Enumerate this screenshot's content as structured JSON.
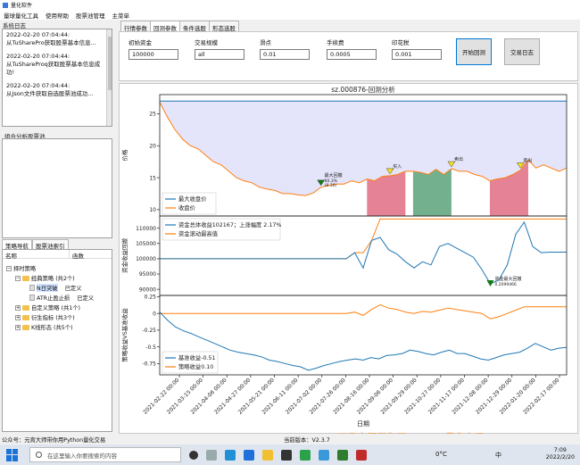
{
  "window": {
    "title": "量化软件"
  },
  "menu": [
    "量球量化工具",
    "使用帮助",
    "股票池管理",
    "主菜单"
  ],
  "log": {
    "title": "系统日志",
    "entries": [
      "2022-02-20 07:04:44:\n从TuSharePro获取股票基本信息...",
      "2022-02-20 07:04:44:\n从TuShareProq获取股票基本信息成功!",
      "2022-02-20 07:04:44:\n从Json文件获取自选股票池成功..."
    ]
  },
  "combo_title": "组合分析股票池",
  "nav_tabs": [
    "策略导航",
    "股票池索引"
  ],
  "tree": {
    "headers": [
      "名称",
      "函数"
    ],
    "rows": [
      {
        "label": "择时策略",
        "value": ""
      },
      {
        "label": "经典策略 (共2个)",
        "value": ""
      },
      {
        "label": "N日突破",
        "value": "已定义"
      },
      {
        "label": "ATR止盈止损",
        "value": "已定义"
      },
      {
        "label": "自定义策略 (共1个)",
        "value": ""
      },
      {
        "label": "衍生指标 (共3个)",
        "value": ""
      },
      {
        "label": "K线形态 (共5个)",
        "value": ""
      }
    ]
  },
  "tabs": [
    "行情参数",
    "回测参数",
    "条件选股",
    "形态选股"
  ],
  "params": {
    "capital": {
      "label": "初始资金",
      "value": "100000"
    },
    "size": {
      "label": "交易规模",
      "value": "all"
    },
    "slippage": {
      "label": "滑点",
      "value": "0.01"
    },
    "fee": {
      "label": "手续费",
      "value": "0.0005"
    },
    "stamp": {
      "label": "印花税",
      "value": "0.001"
    },
    "start_btn": "开始回测",
    "log_btn": "交易日志"
  },
  "status": {
    "left": "公众号：元宵大师带你用Python量化交易",
    "version": "当前版本：V2.3.7"
  },
  "taskbar": {
    "search_placeholder": "在这里输入你要搜索的内容",
    "weather": "0°C",
    "lang": "中",
    "time": "7:09",
    "date": "2022/2/20"
  },
  "watermark": "元宵大师带你用Python量化交易",
  "colors": {
    "blue": "#1f77b4",
    "orange": "#ff7f0e",
    "red_fill": "#e06c84",
    "green_fill": "#5aa37a",
    "lavender": "#e4e4fb"
  },
  "chart_data": [
    {
      "type": "line",
      "title": "sz.000876-回测分析",
      "ylabel": "价格",
      "ylim": [
        9,
        28
      ],
      "yticks": [
        10,
        15,
        20,
        25
      ],
      "series": [
        {
          "name": "最大收盘价",
          "values": [
            27,
            27
          ]
        },
        {
          "name": "收盘价",
          "values": [
            26.8,
            24.5,
            22.5,
            21,
            20,
            19.5,
            18.5,
            17.5,
            17,
            16,
            15,
            14.5,
            14.2,
            13.5,
            13.2,
            13,
            12.5,
            12.5,
            12.3,
            12.2,
            12.6,
            13.5,
            13.8,
            14,
            14,
            14.5,
            14.2,
            14.8,
            14.5,
            15.2,
            15.3,
            15.5,
            16,
            16,
            15.8,
            15.5,
            16.3,
            15.5,
            16.4,
            16,
            16,
            15.5,
            15.2,
            14.5,
            14.8,
            15,
            15.5,
            16.2,
            17.8,
            16.5,
            17,
            16.5,
            16,
            16.5
          ]
        },
        {
          "name": "",
          "values": []
        }
      ],
      "annotations": [
        "买入",
        "卖出",
        "卖出",
        "卖出",
        "最大回撤",
        "60.3%",
        "(8.30)"
      ]
    },
    {
      "type": "line",
      "ylabel": "资金收益回撤",
      "ylim": [
        88000,
        114000
      ],
      "yticks": [
        90000,
        95000,
        100000,
        105000,
        110000
      ],
      "series": [
        {
          "name": "资金总体收益102167；上涨幅度 2.17%",
          "values": [
            100000,
            100000,
            100000,
            100000,
            100000,
            100000,
            100000,
            100000,
            100000,
            100000,
            100000,
            100000,
            100000,
            100000,
            100000,
            100000,
            100000,
            100000,
            100000,
            100000,
            100000,
            100000,
            100000,
            102000,
            97000,
            106000,
            107000,
            103000,
            101500,
            99000,
            97000,
            99000,
            98000,
            104000,
            105000,
            103500,
            102000,
            100500,
            96500,
            91800,
            93000,
            98000,
            108000,
            112000,
            104000,
            102000,
            102167,
            102167,
            102167
          ]
        },
        {
          "name": "资金滚动最高值",
          "values": [
            100000,
            100000,
            100000,
            100000,
            100000,
            100000,
            100000,
            100000,
            100000,
            100000,
            100000,
            100000,
            100000,
            100000,
            100000,
            100000,
            100000,
            100000,
            100000,
            100000,
            100000,
            100000,
            100000,
            102000,
            102000,
            106000,
            113000,
            113000,
            113000,
            113000,
            113000,
            113000,
            113000,
            113000,
            113000,
            113000,
            113000,
            113000,
            113000,
            113000,
            113000,
            113000,
            113000,
            113000,
            113000,
            113000,
            113000,
            113000,
            113000
          ]
        }
      ],
      "annotations": [
        "资金最大回撤",
        "0.2099466"
      ]
    },
    {
      "type": "line",
      "ylabel": "策略收益VS基准收益",
      "xlabel": "日期",
      "ylim": [
        -0.92,
        0.27
      ],
      "yticks": [
        -0.75,
        -0.5,
        -0.25,
        0.0,
        0.25
      ],
      "xticks": [
        "2021-02-22 00:00",
        "2021-03-15 00:00",
        "2021-04-06 00:00",
        "2021-04-27 00:00",
        "2021-05-21 00:00",
        "2021-06-11 00:00",
        "2021-07-02 00:00",
        "2021-07-26 00:00",
        "2021-08-16 00:00",
        "2021-09-06 00:00",
        "2021-09-29 00:00",
        "2021-10-27 00:00",
        "2021-11-17 00:00",
        "2021-12-08 00:00",
        "2021-12-29 00:00",
        "2022-01-20 00:00",
        "2022-02-17 00:00"
      ],
      "series": [
        {
          "name": "基准收益-0.51",
          "values": [
            0.02,
            -0.1,
            -0.2,
            -0.26,
            -0.3,
            -0.35,
            -0.4,
            -0.45,
            -0.5,
            -0.55,
            -0.58,
            -0.6,
            -0.62,
            -0.65,
            -0.7,
            -0.72,
            -0.75,
            -0.78,
            -0.8,
            -0.85,
            -0.82,
            -0.78,
            -0.75,
            -0.72,
            -0.7,
            -0.68,
            -0.7,
            -0.66,
            -0.68,
            -0.63,
            -0.62,
            -0.6,
            -0.55,
            -0.57,
            -0.6,
            -0.62,
            -0.58,
            -0.55,
            -0.6,
            -0.6,
            -0.64,
            -0.68,
            -0.7,
            -0.66,
            -0.62,
            -0.6,
            -0.58,
            -0.52,
            -0.45,
            -0.5,
            -0.55,
            -0.52,
            -0.51
          ]
        },
        {
          "name": "策略收益0.10",
          "values": [
            0,
            0,
            0,
            0,
            0,
            0,
            0,
            0,
            0,
            0,
            0,
            0,
            0,
            0,
            0,
            0,
            0,
            0,
            0,
            0,
            0,
            0,
            0,
            0.02,
            -0.03,
            0.06,
            0.13,
            0.08,
            0.06,
            0.02,
            0.0,
            0.03,
            0.02,
            0.05,
            0.08,
            0.06,
            0.04,
            0.02,
            0.0,
            -0.08,
            -0.05,
            0.0,
            0.05,
            0.1,
            0.1,
            0.1,
            0.1,
            0.1,
            0.1
          ]
        }
      ]
    }
  ]
}
